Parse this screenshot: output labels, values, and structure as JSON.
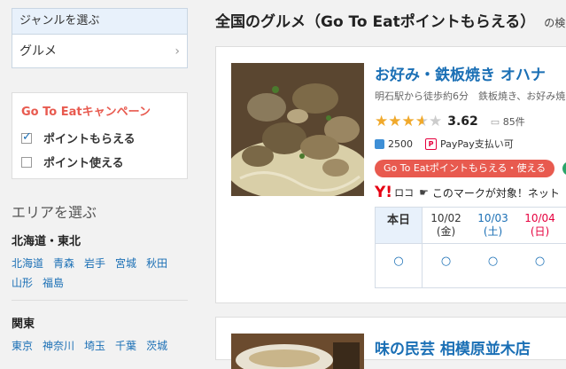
{
  "genre": {
    "heading": "ジャンルを選ぶ",
    "selected": "グルメ"
  },
  "campaign": {
    "title": "Go To Eatキャンペーン",
    "options": [
      {
        "label": "ポイントもらえる",
        "checked": true
      },
      {
        "label": "ポイント使える",
        "checked": false
      }
    ]
  },
  "area": {
    "title": "エリアを選ぶ",
    "regions": [
      {
        "name": "北海道・東北",
        "links": [
          "北海道",
          "青森",
          "岩手",
          "宮城",
          "秋田",
          "山形",
          "福島"
        ]
      },
      {
        "name": "関東",
        "links": [
          "東京",
          "神奈川",
          "埼玉",
          "千葉",
          "茨城"
        ]
      }
    ]
  },
  "page_title": "全国のグルメ（Go To Eatポイントもらえる）",
  "page_title_suffix": "の検",
  "results": [
    {
      "name": "お好み・鉄板焼き オハナ",
      "meta": "明石駅から徒歩約6分　鉄板焼き、お好み焼",
      "rating": 3.62,
      "rating_text": "3.62",
      "reviews": "85件",
      "points": "2500",
      "paypay": "PayPay支払い可",
      "goto_badge": "Go To Eatポイントもらえる・使える",
      "yloco_logo": "Y!",
      "yloco_text": "ロコ",
      "yloco_note": "このマークが対象！ネット",
      "calendar": [
        {
          "date": "本日",
          "day": "",
          "kind": "today",
          "mark": "○"
        },
        {
          "date": "10/02",
          "day": "(金)",
          "kind": "weekday",
          "mark": "○"
        },
        {
          "date": "10/03",
          "day": "(土)",
          "kind": "sat",
          "mark": "○"
        },
        {
          "date": "10/04",
          "day": "(日)",
          "kind": "sun",
          "mark": "○"
        }
      ]
    },
    {
      "name": "味の民芸 相模原並木店"
    }
  ],
  "colors": {
    "link": "#1a6fb5",
    "accent_red": "#e85a4f",
    "star": "#f0a92c",
    "paypay": "#e6003e"
  }
}
